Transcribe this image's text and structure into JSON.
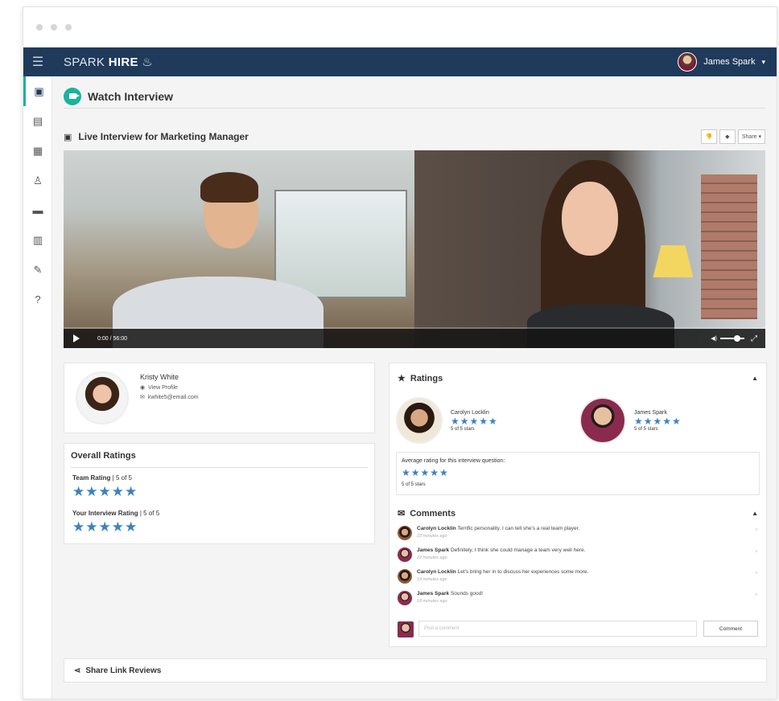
{
  "app": {
    "brand_light": "SPARK ",
    "brand_bold": "HIRE",
    "flame": "♨"
  },
  "user": {
    "name": "James Spark",
    "caret": "▾"
  },
  "sidebar_icons": [
    "interview-icon",
    "briefcase-icon",
    "calendar-icon",
    "people-icon",
    "folder-icon",
    "chart-icon",
    "edit-icon",
    "help-icon"
  ],
  "page": {
    "title": "Watch Interview"
  },
  "section": {
    "title": "Live Interview for Marketing Manager",
    "share_label": "Share ▾"
  },
  "video": {
    "time": "0:00 / 56:00",
    "progress": 0.0,
    "volume": 0.55
  },
  "candidate": {
    "name": "Kristy White",
    "view_profile": "View Profile",
    "email": "kwhite5@email.com"
  },
  "overall": {
    "title": "Overall Ratings",
    "team_label": "Team Rating",
    "team_value": "| 5 of 5",
    "team_stars": "★★★★★",
    "your_label": "Your Interview Rating",
    "your_value": "| 5 of 5",
    "your_stars": "★★★★★"
  },
  "ratings": {
    "title": "Ratings",
    "raters": [
      {
        "name": "Carolyn Locklin",
        "stars": "★★★★★",
        "sub": "5 of 5 stars"
      },
      {
        "name": "James Spark",
        "stars": "★★★★★",
        "sub": "5 of 5 stars"
      }
    ],
    "avg_title": "Average rating for this interview question:",
    "avg_stars": "★★★★★",
    "avg_sub": "5 of 5 stars"
  },
  "comments": {
    "title": "Comments",
    "items": [
      {
        "author": "Carolyn Locklin",
        "text": "Terrific personality. I can tell she's a real team player.",
        "ago": "23 minutes ago"
      },
      {
        "author": "James Spark",
        "text": "Definitely, I think she could manage a team very well here.",
        "ago": "22 minutes ago"
      },
      {
        "author": "Carolyn Locklin",
        "text": "Let's bring her in to discuss her experiences some more.",
        "ago": "19 minutes ago"
      },
      {
        "author": "James Spark",
        "text": "Sounds good!",
        "ago": "18 minutes ago"
      }
    ],
    "placeholder": "Post a comment",
    "button": "Comment"
  },
  "share_link": {
    "label": "Share Link Reviews"
  }
}
